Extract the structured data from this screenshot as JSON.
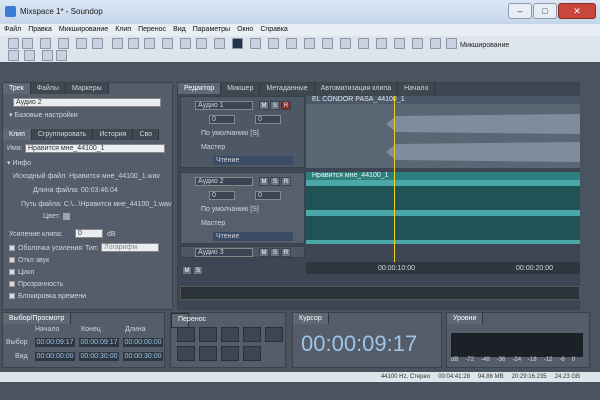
{
  "window": {
    "title": "Mixspace 1* - Soundop"
  },
  "menu": [
    "Файл",
    "Правка",
    "Микширование",
    "Клип",
    "Перенос",
    "Вид",
    "Параметры",
    "Окно",
    "Справка"
  ],
  "toolbar": {
    "mix_mode": "Микширование"
  },
  "left": {
    "tabs1": [
      "Трек",
      "Файлы",
      "Маркеры"
    ],
    "track_name": "Аудио 2",
    "section_basic": "Базовые настройки",
    "tabs2": [
      "Клип",
      "Сгруппировать",
      "История",
      "Сво"
    ],
    "name_label": "Имя:",
    "name_value": "Нравится мне_44100_1",
    "info_header": "Инфо",
    "src_file": "Исходный файл: Нравится мне_44100_1.wav",
    "file_len": "Длина файла: 00:03:46:04",
    "file_path": "Путь файла: C:\\...\\Нравится мне_44100_1.wav",
    "color_label": "Цвет:",
    "gain_label": "Усиление клипа:",
    "gain_value": "0",
    "gain_unit": "dB",
    "checks": [
      "Оболочка усиления",
      "Откл звук",
      "Цикл",
      "Прозрачность",
      "Блокировка времени"
    ],
    "type_label": "Тип:",
    "type_value": "Логарифм"
  },
  "editor": {
    "tabs": [
      "Редактор",
      "Микшер",
      "Метаданные",
      "Автоматизация клипа",
      "Начало"
    ],
    "tracks": [
      {
        "name": "Аудио 1",
        "vol": "0",
        "pan": "0",
        "preset": "По умолчанию [S]",
        "out": "Мастер",
        "mode": "Чтение",
        "clip": "EL CÓNDOR PASA_44100_1"
      },
      {
        "name": "Аудио 2",
        "vol": "0",
        "pan": "0",
        "preset": "По умолчанию [S]",
        "out": "Мастер",
        "mode": "Чтение",
        "clip": "Нравится мне_44100_1"
      },
      {
        "name": "Аудио 3"
      }
    ],
    "ruler": [
      "00:00:10:00",
      "00:00:20:00"
    ],
    "msr": [
      "M",
      "S",
      "R"
    ]
  },
  "bottom": {
    "sel_title": "Выбор/Просмотр",
    "cols": [
      "Начало",
      "Конец",
      "Длина"
    ],
    "rows": [
      {
        "label": "Выбор",
        "vals": [
          "00:00:09:17",
          "00:00:09:17",
          "00:00:00:00"
        ]
      },
      {
        "label": "Вид",
        "vals": [
          "00:00:00:00",
          "00:00:30:00",
          "00:00:30:00"
        ]
      }
    ],
    "transport_title": "Перенос",
    "cursor_title": "Курсор",
    "cursor_time": "00:00:09:17",
    "levels_title": "Уровни",
    "levels_ticks": [
      "dB",
      "-72",
      "-48",
      "-36",
      "-24",
      "-18",
      "-12",
      "-6",
      "0"
    ]
  },
  "status": [
    "44100 Hz, Стерео",
    "00:04:41:28",
    "94.86 MB",
    "20:29:16.235",
    "24.23 GB"
  ]
}
